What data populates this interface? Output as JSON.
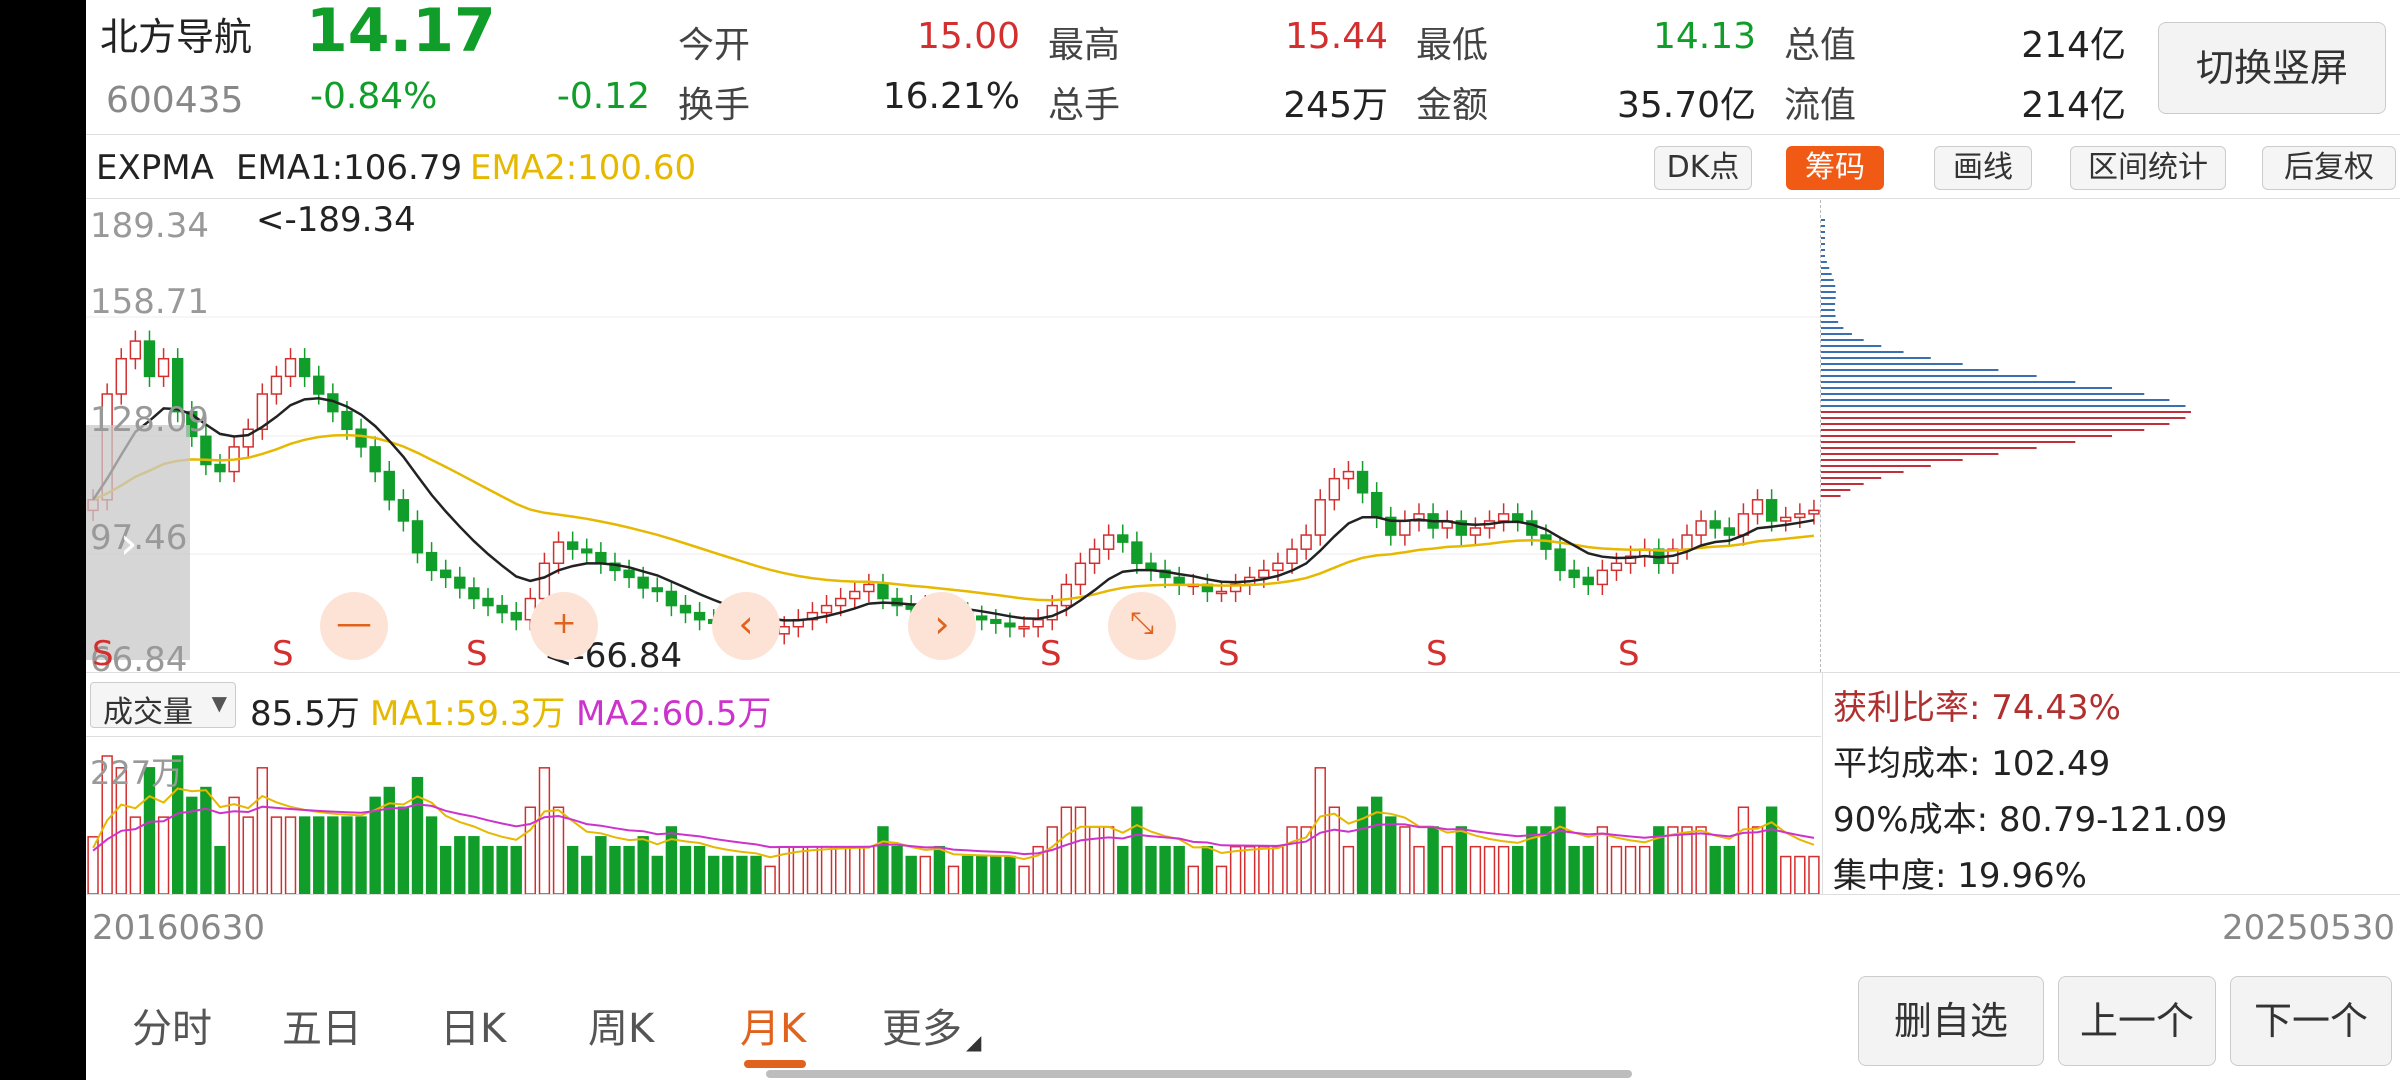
{
  "stock": {
    "name": "北方导航",
    "code": "600435",
    "price": "14.17",
    "change_pct": "-0.84%",
    "change": "-0.12"
  },
  "quote": [
    {
      "label": "今开",
      "value": "15.00",
      "color": "red"
    },
    {
      "label": "最高",
      "value": "15.44",
      "color": "red"
    },
    {
      "label": "最低",
      "value": "14.13",
      "color": "green"
    },
    {
      "label": "总值",
      "value": "214亿",
      "color": "black"
    },
    {
      "label": "换手",
      "value": "16.21%",
      "color": "black"
    },
    {
      "label": "总手",
      "value": "245万",
      "color": "black"
    },
    {
      "label": "金额",
      "value": "35.70亿",
      "color": "black"
    },
    {
      "label": "流值",
      "value": "214亿",
      "color": "black"
    }
  ],
  "switch_button": "切换竖屏",
  "indicator_bar": {
    "name": "EXPMA",
    "ema1": "EMA1:106.79",
    "ema2": "EMA2:100.60",
    "tools": [
      "DK点",
      "筹码",
      "画线",
      "区间统计",
      "后复权"
    ],
    "active_tool": "筹码"
  },
  "price_axis": [
    "189.34",
    "158.71",
    "128.09",
    "97.46",
    "66.84"
  ],
  "markers": {
    "high": "<-189.34",
    "low": "<-66.84",
    "s_label": "S",
    "dash": "—"
  },
  "volume_bar": {
    "selector": "成交量",
    "current": "85.5万",
    "ma1": "MA1:59.3万",
    "ma2": "MA2:60.5万",
    "axis_top": "227万"
  },
  "chip_stats": {
    "profit_ratio": "获利比率: 74.43%",
    "avg_cost": "平均成本: 102.49",
    "cost90": "90%成本:  80.79-121.09",
    "concentration": "集中度: 19.96%"
  },
  "dates": {
    "start": "20160630",
    "end": "20250530"
  },
  "period_tabs": [
    "分时",
    "五日",
    "日K",
    "周K",
    "月K",
    "更多"
  ],
  "active_period": "月K",
  "nav_buttons": {
    "remove": "删自选",
    "prev": "上一个",
    "next": "下一个"
  },
  "colors": {
    "up": "#d32f2f",
    "down": "#119d2a",
    "ema1": "#222222",
    "ema2": "#e6b800",
    "accent": "#f05a14",
    "ma2": "#cc33cc"
  },
  "chart_data": {
    "type": "candlestick",
    "period": "monthly",
    "x_range": [
      "20160630",
      "20250530"
    ],
    "ylim": [
      66.84,
      189.34
    ],
    "visible_high": 189.34,
    "visible_low": 66.84,
    "ema1_last": 106.79,
    "ema2_last": 100.6,
    "volume_max": "227万",
    "volume_last": "85.5万",
    "volume_ma1_last": "59.3万",
    "volume_ma2_last": "60.5万",
    "closes": [
      110,
      140,
      150,
      155,
      145,
      150,
      135,
      128,
      120,
      118,
      125,
      130,
      140,
      145,
      150,
      145,
      140,
      135,
      130,
      125,
      118,
      110,
      104,
      95,
      90,
      88,
      85,
      82,
      80,
      78,
      76,
      82,
      92,
      98,
      96,
      95,
      92,
      90,
      88,
      85,
      84,
      80,
      78,
      76,
      75,
      74,
      73,
      72,
      72,
      74,
      76,
      78,
      80,
      82,
      84,
      86,
      82,
      80,
      79,
      80,
      78,
      78,
      77,
      76,
      75,
      74,
      74,
      76,
      80,
      86,
      92,
      96,
      100,
      98,
      92,
      90,
      88,
      86,
      86,
      84,
      84,
      86,
      88,
      90,
      92,
      96,
      100,
      110,
      116,
      118,
      112,
      105,
      100,
      104,
      106,
      102,
      104,
      100,
      102,
      104,
      106,
      104,
      100,
      96,
      90,
      88,
      86,
      90,
      92,
      94,
      96,
      92,
      96,
      100,
      104,
      102,
      100,
      106,
      110,
      104,
      105,
      106,
      107
    ]
  }
}
